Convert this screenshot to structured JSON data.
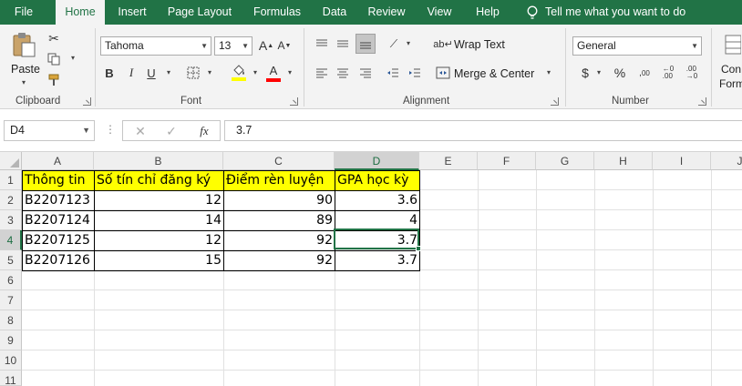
{
  "tabs": [
    "File",
    "Home",
    "Insert",
    "Page Layout",
    "Formulas",
    "Data",
    "Review",
    "View",
    "Help"
  ],
  "active_tab": "Home",
  "tell_me": "Tell me what you want to do",
  "clipboard": {
    "paste_label": "Paste",
    "group_label": "Clipboard"
  },
  "font": {
    "name": "Tahoma",
    "size": "13",
    "group_label": "Font",
    "fill_color": "#ffff00",
    "font_color": "#ff0000"
  },
  "alignment": {
    "wrap_text": "Wrap Text",
    "merge_center": "Merge & Center",
    "group_label": "Alignment"
  },
  "number": {
    "format": "General",
    "group_label": "Number",
    "currency_symbol": "$",
    "percent_symbol": "%"
  },
  "styles": {
    "cond_label_1": "Con",
    "cond_label_2": "Form"
  },
  "formula_bar": {
    "name_box": "D4",
    "formula": "3.7",
    "fx": "fx"
  },
  "columns": [
    "A",
    "B",
    "C",
    "D",
    "E",
    "F",
    "G",
    "H",
    "I",
    "J"
  ],
  "selected_column": "D",
  "rows": [
    "1",
    "2",
    "3",
    "4",
    "5",
    "6",
    "7",
    "8",
    "9",
    "10",
    "11"
  ],
  "selected_row": "4",
  "header_row": [
    "Thông tin",
    "Số tín chỉ đăng ký",
    "Điểm rèn luyện",
    "GPA học kỳ"
  ],
  "data_rows": [
    [
      "B2207123",
      "12",
      "90",
      "3.6"
    ],
    [
      "B2207124",
      "14",
      "89",
      "4"
    ],
    [
      "B2207125",
      "12",
      "92",
      "3.7"
    ],
    [
      "B2207126",
      "15",
      "92",
      "3.7"
    ]
  ],
  "colors": {
    "ribbon_green": "#217346",
    "header_fill": "#ffff00"
  }
}
